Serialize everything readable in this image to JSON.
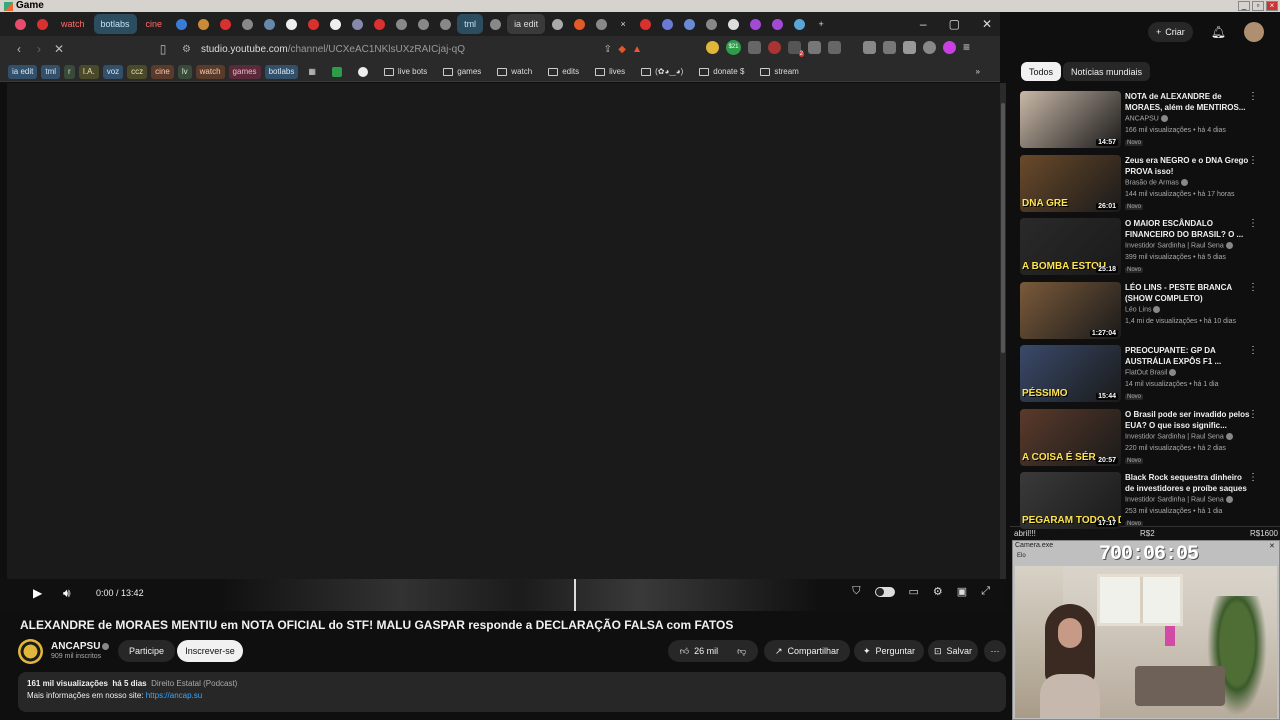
{
  "os": {
    "window_title": "Game"
  },
  "browser": {
    "tabs": [
      {
        "label": "",
        "color": "#e94b6a"
      },
      {
        "label": "",
        "color": "#d93030"
      },
      {
        "label": "watch",
        "style": "red"
      },
      {
        "label": "botlabs",
        "style": "blue"
      },
      {
        "label": "cine",
        "style": "red"
      },
      {
        "label": "",
        "color": "#3a7bd5"
      },
      {
        "label": "",
        "color": "#c98a3a"
      },
      {
        "label": "",
        "color": "#d93030"
      },
      {
        "label": "",
        "color": "#888888"
      },
      {
        "label": "",
        "color": "#6688aa"
      },
      {
        "label": "",
        "color": "#eeeeee"
      },
      {
        "label": "",
        "color": "#d93030"
      },
      {
        "label": "",
        "color": "#eeeeee"
      },
      {
        "label": "",
        "color": "#8888aa"
      },
      {
        "label": "",
        "color": "#d93030"
      },
      {
        "label": "",
        "color": "#888888"
      },
      {
        "label": "",
        "color": "#888888"
      },
      {
        "label": "",
        "color": "#888888"
      },
      {
        "label": "tml",
        "style": "blue"
      },
      {
        "label": "",
        "color": "#888888"
      },
      {
        "label": "ia edit",
        "style": "active"
      },
      {
        "label": "",
        "color": "#aaaaaa"
      },
      {
        "label": "",
        "color": "#e05a2a"
      },
      {
        "label": "",
        "color": "#888888"
      },
      {
        "label": "",
        "color": "#d93030"
      },
      {
        "label": "",
        "color": "#6a7ad5"
      },
      {
        "label": "",
        "color": "#6a8ad5"
      },
      {
        "label": "",
        "color": "#888888"
      },
      {
        "label": "",
        "color": "#dddddd"
      },
      {
        "label": "",
        "color": "#a34ad5"
      },
      {
        "label": "",
        "color": "#a34ad5"
      },
      {
        "label": "",
        "color": "#5aa5d5"
      }
    ],
    "close_tab_symbol": "×",
    "new_tab_symbol": "+",
    "url_host": "studio.youtube.com",
    "url_path": "/channel/UCXeAC1NKlsUXzRAICjaj-qQ",
    "bookmarks": [
      {
        "label": "ia edit",
        "style": "c1"
      },
      {
        "label": "tml",
        "style": "c1"
      },
      {
        "label": "r",
        "style": "c4"
      },
      {
        "label": "I.A.",
        "style": "c2"
      },
      {
        "label": "voz",
        "style": "c1"
      },
      {
        "label": "ccz",
        "style": "c2"
      },
      {
        "label": "cine",
        "style": "c3"
      },
      {
        "label": "lv",
        "style": "c4"
      },
      {
        "label": "watch",
        "style": "c3"
      },
      {
        "label": "games",
        "style": "c5"
      },
      {
        "label": "botlabs",
        "style": "c1"
      }
    ],
    "bookmark_folders": [
      "live bots",
      "games",
      "watch",
      "edits",
      "lives",
      "(✿◕‿◕)",
      "donate $",
      "stream"
    ],
    "extensions_badge": "$21",
    "badge_two": "2"
  },
  "player": {
    "time_current": "0:00",
    "time_total": "13:42"
  },
  "video": {
    "title": "ALEXANDRE de MORAES MENTIU em NOTA OFICIAL do STF! MALU GASPAR responde a DECLARAÇÃO FALSA com FATOS",
    "channel_name": "ANCAPSU",
    "channel_subs": "909 mil inscritos",
    "join_label": "Participe",
    "subscribe_label": "Inscrever-se",
    "likes": "26 mil",
    "share_label": "Compartilhar",
    "ask_label": "Perguntar",
    "save_label": "Salvar",
    "views": "161 mil visualizações",
    "age": "há 5 dias",
    "tag": "Direito Estatal (Podcast)",
    "desc_line": "Mais informações em nosso site:",
    "desc_link": "https://ancap.su"
  },
  "sidebar": {
    "create_label": "Criar",
    "chips": [
      "Todos",
      "Notícias mundiais"
    ],
    "recommendations": [
      {
        "title": "NOTA de ALEXANDRE de MORAES, além de MENTIROS...",
        "channel": "ANCAPSU",
        "views": "166 mil visualizações",
        "age": "há 4 dias",
        "duration": "14:57",
        "badge": "Novo",
        "thumb_text": "",
        "thumb_bg": "#c9b8a8"
      },
      {
        "title": "Zeus era NEGRO e o DNA Grego PROVA isso!",
        "channel": "Brasão de Armas",
        "views": "144 mil visualizações",
        "age": "há 17 horas",
        "duration": "26:01",
        "badge": "Novo",
        "thumb_text": "DNA GRE",
        "thumb_bg": "#6a4a2a"
      },
      {
        "title": "O MAIOR ESCÂNDALO FINANCEIRO DO BRASIL? O ...",
        "channel": "Investidor Sardinha | Raul Sena",
        "views": "399 mil visualizações",
        "age": "há 5 dias",
        "duration": "25:18",
        "badge": "Novo",
        "thumb_text": "A BOMBA ESTOU",
        "thumb_bg": "#2a2a2a"
      },
      {
        "title": "LÉO LINS - PESTE BRANCA (SHOW COMPLETO)",
        "channel": "Léo Lins",
        "views": "1,4 mi de visualizações",
        "age": "há 10 dias",
        "duration": "1:27:04",
        "badge": "",
        "thumb_text": "",
        "thumb_bg": "#7a5a3a"
      },
      {
        "title": "PREOCUPANTE: GP DA AUSTRÁLIA EXPÔS F1 ...",
        "channel": "FlatOut Brasil",
        "views": "14 mil visualizações",
        "age": "há 1 dia",
        "duration": "15:44",
        "badge": "Novo",
        "thumb_text": "PÉSSIMO",
        "thumb_bg": "#3a4a6a"
      },
      {
        "title": "O Brasil pode ser invadido pelos EUA? O que isso signific...",
        "channel": "Investidor Sardinha | Raul Sena",
        "views": "220 mil visualizações",
        "age": "há 2 dias",
        "duration": "20:57",
        "badge": "Novo",
        "thumb_text": "A COISA É SÉR",
        "thumb_bg": "#5a3a2a"
      },
      {
        "title": "Black Rock sequestra dinheiro de investidores e proíbe saques",
        "channel": "Investidor Sardinha | Raul Sena",
        "views": "253 mil visualizações",
        "age": "há 1 dia",
        "duration": "17:17",
        "badge": "Novo",
        "thumb_text": "PEGARAM TODO O DI",
        "thumb_bg": "#3a3a3a"
      }
    ]
  },
  "stream_overlay": {
    "left_text": "abril!!!",
    "mid_text": "R$2",
    "right_text": "R$1600",
    "camera_title": "Camera.exe",
    "camera_sub": "Elo",
    "timer": "700:06:05"
  }
}
